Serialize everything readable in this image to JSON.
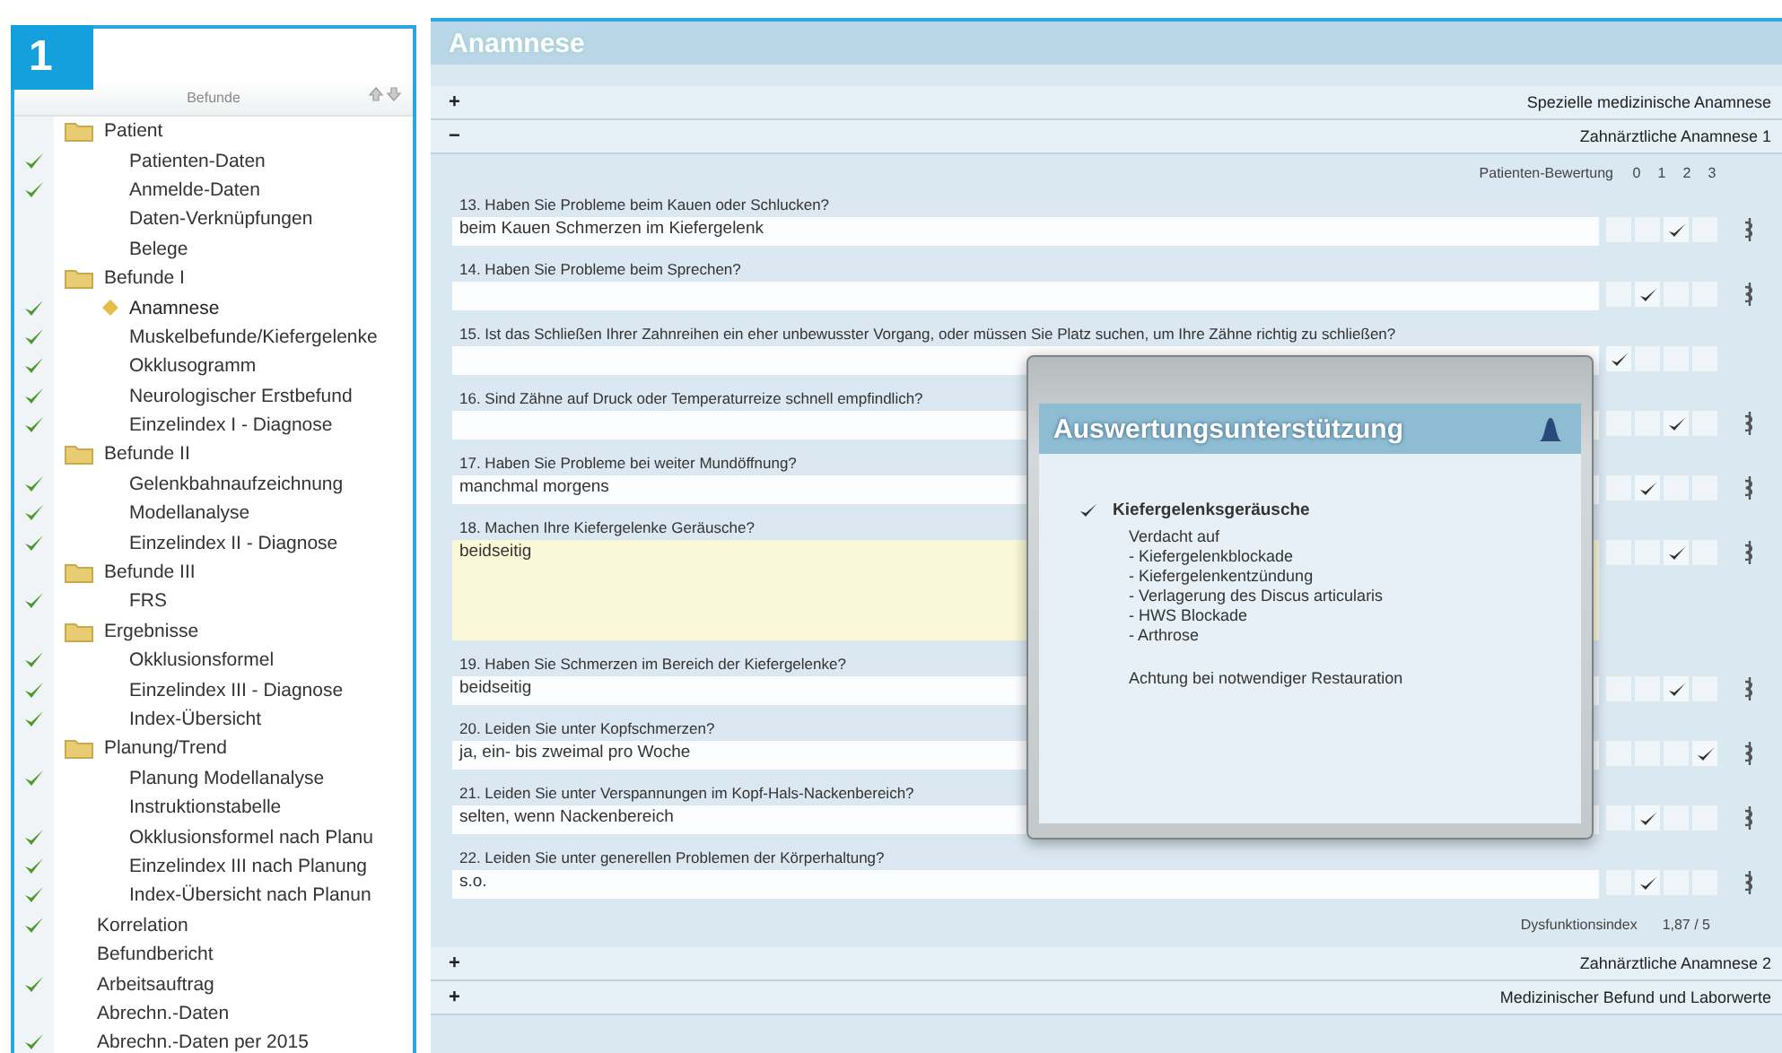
{
  "figure_number": "1",
  "sidebar": {
    "title": "Befunde",
    "items": [
      {
        "label": "Patient",
        "selected": false,
        "children": [
          {
            "label": "Patienten-Daten",
            "checked": true,
            "selected": false
          },
          {
            "label": "Anmelde-Daten",
            "checked": true,
            "selected": false
          },
          {
            "label": "Daten-Verknüpfungen",
            "checked": false,
            "selected": false
          },
          {
            "label": "Belege",
            "checked": false,
            "selected": false
          }
        ]
      },
      {
        "label": "Befunde I",
        "selected": false,
        "children": [
          {
            "label": "Anamnese",
            "checked": true,
            "selected": true
          },
          {
            "label": "Muskelbefunde/Kiefergelenke",
            "checked": true,
            "selected": false
          },
          {
            "label": "Okklusogramm",
            "checked": true,
            "selected": false
          },
          {
            "label": "Neurologischer Erstbefund",
            "checked": true,
            "selected": false
          },
          {
            "label": "Einzelindex I - Diagnose",
            "checked": true,
            "selected": false
          }
        ]
      },
      {
        "label": "Befunde II",
        "selected": false,
        "children": [
          {
            "label": "Gelenkbahnaufzeichnung",
            "checked": true,
            "selected": false
          },
          {
            "label": "Modellanalyse",
            "checked": true,
            "selected": false
          },
          {
            "label": "Einzelindex II - Diagnose",
            "checked": true,
            "selected": false
          }
        ]
      },
      {
        "label": "Befunde III",
        "selected": false,
        "children": [
          {
            "label": "FRS",
            "checked": true,
            "selected": false
          }
        ]
      },
      {
        "label": "Ergebnisse",
        "selected": false,
        "children": [
          {
            "label": "Okklusionsformel",
            "checked": true,
            "selected": false
          },
          {
            "label": "Einzelindex III - Diagnose",
            "checked": true,
            "selected": false
          },
          {
            "label": "Index-Übersicht",
            "checked": true,
            "selected": false
          }
        ]
      },
      {
        "label": "Planung/Trend",
        "selected": false,
        "children": [
          {
            "label": "Planung Modellanalyse",
            "checked": true,
            "selected": false
          },
          {
            "label": "Instruktionstabelle",
            "checked": false,
            "selected": false
          },
          {
            "label": "Okklusionsformel nach Planu",
            "checked": true,
            "selected": false
          },
          {
            "label": "Einzelindex III nach Planung",
            "checked": true,
            "selected": false
          },
          {
            "label": "Index-Übersicht nach Planun",
            "checked": true,
            "selected": false
          }
        ]
      },
      {
        "label": "Korrelation",
        "checked": true,
        "selected": false
      },
      {
        "label": "Befundbericht",
        "checked": false,
        "selected": false
      },
      {
        "label": "Arbeitsauftrag",
        "checked": true,
        "selected": false
      },
      {
        "label": "Abrechn.-Daten",
        "checked": false,
        "selected": false
      },
      {
        "label": "Abrechn.-Daten per 2015",
        "checked": true,
        "selected": false
      }
    ]
  },
  "panel": {
    "title": "Anamnese",
    "sections": [
      {
        "toggle": "+",
        "label": "Spezielle medizinische Anamnese"
      },
      {
        "toggle": "−",
        "label": "Zahnärztliche Anamnese 1",
        "rating_header": {
          "label": "Patienten-Bewertung",
          "scores": [
            "0",
            "1",
            "2",
            "3"
          ]
        },
        "questions": [
          {
            "question": "13. Haben Sie Probleme beim Kauen oder Schlucken?",
            "answer": "beim Kauen Schmerzen im Kiefergelenk",
            "highlighted": false,
            "note_icon": true,
            "ratings": [
              {
                "selected": false
              },
              {
                "selected": false
              },
              {
                "selected": true
              },
              {
                "selected": false
              }
            ]
          },
          {
            "question": "14. Haben Sie Probleme beim Sprechen?",
            "highlighted": false,
            "note_icon": true,
            "ratings": [
              {
                "selected": false
              },
              {
                "selected": true
              },
              {
                "selected": false
              },
              {
                "selected": false
              }
            ]
          },
          {
            "question": "15. Ist das Schließen Ihrer Zahnreihen ein eher unbewusster Vorgang, oder müssen Sie Platz suchen, um Ihre Zähne richtig zu schließen?",
            "highlighted": false,
            "note_icon": false,
            "ratings": [
              {
                "selected": true
              },
              {
                "selected": false
              },
              {
                "selected": false
              },
              {
                "selected": false
              }
            ]
          },
          {
            "question": "16. Sind Zähne auf Druck oder Temperaturreize schnell empfindlich?",
            "highlighted": false,
            "note_icon": true,
            "ratings": [
              {
                "selected": false
              },
              {
                "selected": false
              },
              {
                "selected": true
              },
              {
                "selected": false
              }
            ]
          },
          {
            "question": "17. Haben Sie Probleme bei weiter Mundöffnung?",
            "answer": "manchmal morgens",
            "highlighted": false,
            "note_icon": true,
            "ratings": [
              {
                "selected": false
              },
              {
                "selected": true
              },
              {
                "selected": false
              },
              {
                "selected": false
              }
            ]
          },
          {
            "question": "18. Machen Ihre Kiefergelenke Geräusche?",
            "answer": "beidseitig",
            "highlighted": true,
            "note_icon": true,
            "ratings": [
              {
                "selected": false
              },
              {
                "selected": false
              },
              {
                "selected": true
              },
              {
                "selected": false
              }
            ]
          },
          {
            "question": "19. Haben Sie Schmerzen im Bereich der Kiefergelenke?",
            "answer": "beidseitig",
            "highlighted": false,
            "note_icon": true,
            "ratings": [
              {
                "selected": false
              },
              {
                "selected": false
              },
              {
                "selected": true
              },
              {
                "selected": false
              }
            ]
          },
          {
            "question": "20. Leiden Sie unter Kopfschmerzen?",
            "answer": "ja, ein- bis zweimal pro Woche",
            "highlighted": false,
            "note_icon": true,
            "ratings": [
              {
                "selected": false
              },
              {
                "selected": false
              },
              {
                "selected": false
              },
              {
                "selected": true
              }
            ]
          },
          {
            "question": "21. Leiden Sie unter Verspannungen im Kopf-Hals-Nackenbereich?",
            "answer": "selten, wenn Nackenbereich",
            "highlighted": false,
            "note_icon": true,
            "ratings": [
              {
                "selected": false
              },
              {
                "selected": true
              },
              {
                "selected": false
              },
              {
                "selected": false
              }
            ]
          },
          {
            "question": "22. Leiden Sie unter generellen Problemen der Körperhaltung?",
            "answer": "s.o.",
            "highlighted": false,
            "note_icon": true,
            "ratings": [
              {
                "selected": false
              },
              {
                "selected": true
              },
              {
                "selected": false
              },
              {
                "selected": false
              }
            ]
          }
        ],
        "index": {
          "label": "Dysfunktionsindex",
          "value": "1,87 / 5"
        }
      },
      {
        "toggle": "+",
        "label": "Zahnärztliche Anamnese 2"
      },
      {
        "toggle": "+",
        "label": "Medizinischer Befund und Laborwerte"
      }
    ]
  },
  "popup": {
    "title": "Auswertungsunterstützung",
    "finding": {
      "label": "Kiefergelenksgeräusche",
      "checked": true
    },
    "lines": [
      "Verdacht auf",
      "- Kiefergelenkblockade",
      "- Kiefergelenkentzündung",
      "- Verlagerung des Discus articularis",
      "- HWS Blockade",
      "- Arthrose"
    ],
    "note": "Achtung bei notwendiger Restauration"
  }
}
